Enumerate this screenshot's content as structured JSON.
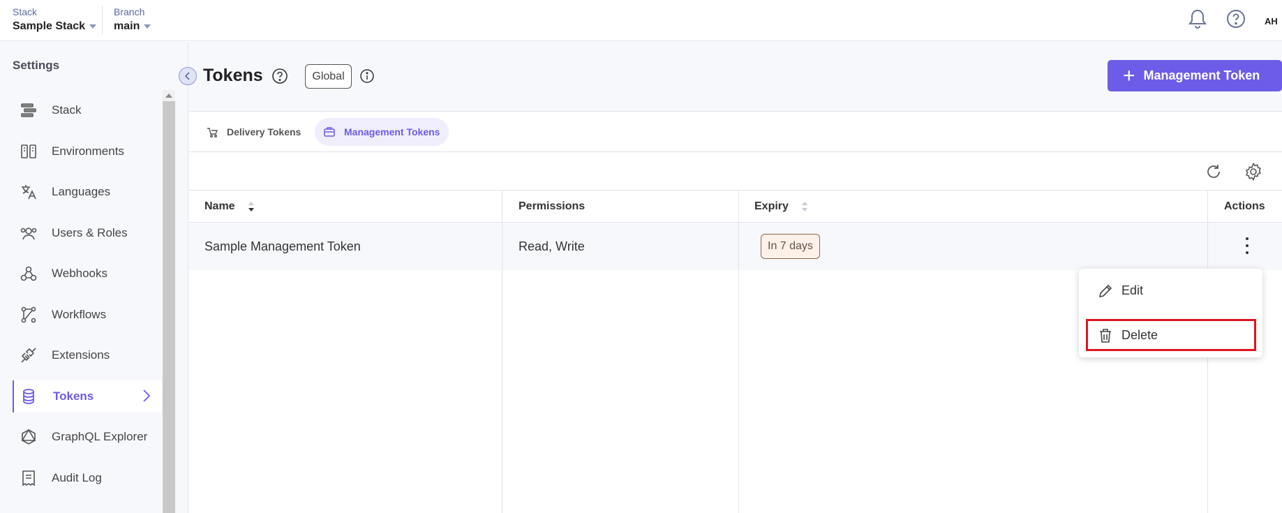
{
  "topbar": {
    "stack_label": "Stack",
    "stack_value": "Sample Stack",
    "branch_label": "Branch",
    "branch_value": "main",
    "avatar_initials": "AH"
  },
  "sidebar": {
    "title": "Settings",
    "items": [
      {
        "label": "Stack",
        "icon": "stack-icon"
      },
      {
        "label": "Environments",
        "icon": "environments-icon"
      },
      {
        "label": "Languages",
        "icon": "languages-icon"
      },
      {
        "label": "Users & Roles",
        "icon": "users-icon"
      },
      {
        "label": "Webhooks",
        "icon": "webhooks-icon"
      },
      {
        "label": "Workflows",
        "icon": "workflows-icon"
      },
      {
        "label": "Extensions",
        "icon": "extensions-icon"
      },
      {
        "label": "Tokens",
        "icon": "database-icon",
        "active": true
      },
      {
        "label": "GraphQL Explorer",
        "icon": "graphql-icon"
      },
      {
        "label": "Audit Log",
        "icon": "audit-log-icon"
      }
    ]
  },
  "header": {
    "title": "Tokens",
    "scope_badge": "Global",
    "primary_button": "Management Token"
  },
  "tabs": [
    {
      "label": "Delivery Tokens",
      "active": false
    },
    {
      "label": "Management Tokens",
      "active": true
    }
  ],
  "table": {
    "columns": [
      "Name",
      "Permissions",
      "Expiry",
      "Actions"
    ],
    "rows": [
      {
        "name": "Sample Management Token",
        "permissions": "Read, Write",
        "expiry": "In 7 days"
      }
    ]
  },
  "row_menu": {
    "items": [
      {
        "label": "Edit",
        "icon": "pencil-icon"
      },
      {
        "label": "Delete",
        "icon": "trash-icon",
        "highlighted": true
      }
    ]
  },
  "colors": {
    "accent": "#6c5ce7",
    "highlight": "#e0151f"
  }
}
